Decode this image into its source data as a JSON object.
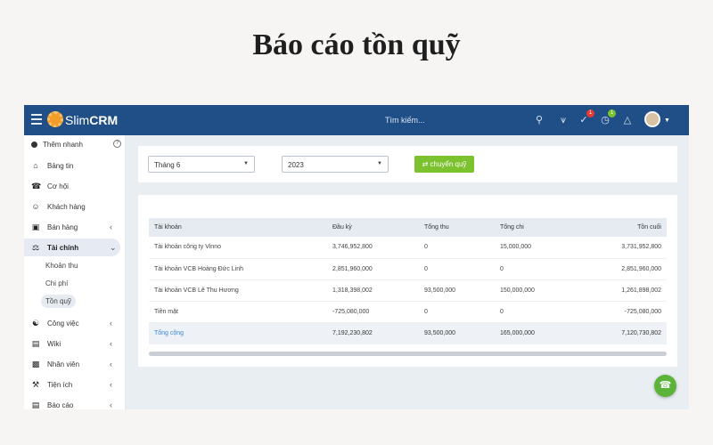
{
  "heading": "Báo cáo tồn quỹ",
  "topbar": {
    "logo_prefix": "Slim",
    "logo_suffix": "CRM",
    "search_placeholder": "Tìm kiếm...",
    "notif_badge_1": "1",
    "notif_badge_2": "1",
    "colors": {
      "bar": "#1f4f86",
      "badge_red": "#e53935",
      "badge_green": "#7cc12e"
    }
  },
  "sidebar": {
    "add_label": "Thêm nhanh",
    "help": "?",
    "items": [
      {
        "label": "Bảng tin",
        "icon": "home-icon"
      },
      {
        "label": "Cơ hội",
        "icon": "phone-icon"
      },
      {
        "label": "Khách hàng",
        "icon": "user-icon"
      },
      {
        "label": "Bán hàng",
        "icon": "cart-icon"
      },
      {
        "label": "Tài chính",
        "icon": "scale-icon"
      },
      {
        "label": "Công việc",
        "icon": "handshake-icon"
      },
      {
        "label": "Wiki",
        "icon": "wiki-icon"
      },
      {
        "label": "Nhân viên",
        "icon": "id-card-icon"
      },
      {
        "label": "Tiện ích",
        "icon": "wrench-icon"
      },
      {
        "label": "Báo cáo",
        "icon": "chart-icon"
      }
    ],
    "sub_items": [
      "Khoản thu",
      "Chi phí",
      "Tồn quỹ"
    ]
  },
  "filter": {
    "month": "Tháng 6",
    "year": "2023",
    "transfer_button": "chuyển quỹ"
  },
  "table": {
    "headers": [
      "Tài khoản",
      "Đầu kỳ",
      "Tổng thu",
      "Tổng chi",
      "Tồn cuối"
    ],
    "rows": [
      [
        "Tài khoản công ty Vinno",
        "3,746,952,800",
        "0",
        "15,000,000",
        "3,731,952,800"
      ],
      [
        "Tài khoản VCB Hoàng Đức Linh",
        "2,851,960,000",
        "0",
        "0",
        "2,851,960,000"
      ],
      [
        "Tài khoản VCB Lê Thu Hương",
        "1,318,398,002",
        "93,500,000",
        "150,000,000",
        "1,261,898,002"
      ],
      [
        "Tiền mặt",
        "-725,080,000",
        "0",
        "0",
        "-725,080,000"
      ]
    ],
    "total": [
      "Tổng cộng",
      "7,192,230,802",
      "93,500,000",
      "165,000,000",
      "7,120,730,802"
    ]
  }
}
